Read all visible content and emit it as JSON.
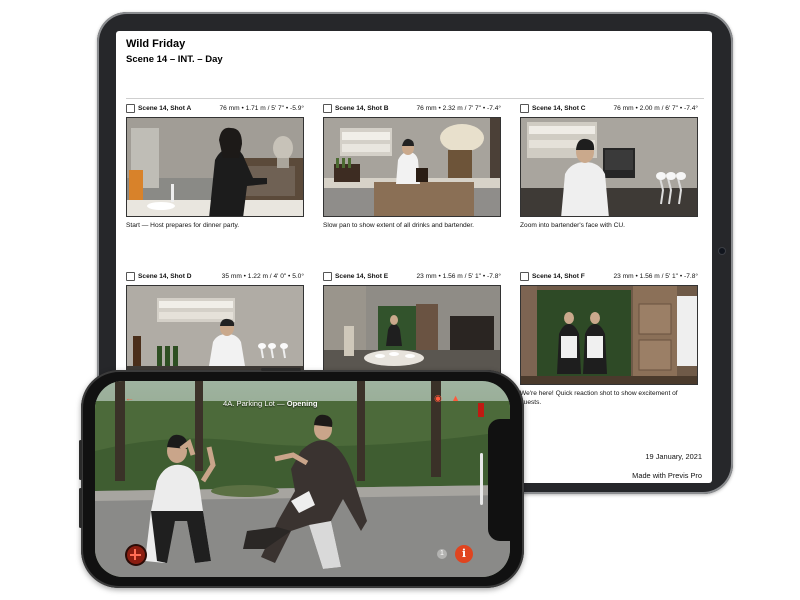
{
  "document": {
    "title": "Wild Friday",
    "scene": "Scene 14 – INT. – Day",
    "date": "19 January, 2021",
    "footer": "Made with Previs Pro"
  },
  "shots": [
    {
      "name": "Scene 14, Shot A",
      "lens": "76 mm • 1.71 m / 5' 7\" • -5.9°",
      "caption": "Start — Host prepares for dinner party."
    },
    {
      "name": "Scene 14, Shot B",
      "lens": "76 mm • 2.32 m / 7' 7\" • -7.4°",
      "caption": "Slow pan to show extent of all drinks and bartender."
    },
    {
      "name": "Scene 14, Shot C",
      "lens": "76 mm • 2.00 m / 6' 7\" • -7.4°",
      "caption": "Zoom into bartender's face with CU."
    },
    {
      "name": "Scene 14, Shot D",
      "lens": "35 mm • 1.22 m / 4' 0\" • 5.0°",
      "caption": ""
    },
    {
      "name": "Scene 14, Shot E",
      "lens": "23 mm • 1.56 m / 5' 1\" • -7.8°",
      "caption": ""
    },
    {
      "name": "Scene 14, Shot F",
      "lens": "23 mm • 1.56 m / 5' 1\" • -7.8°",
      "caption": "We're here! Quick reaction shot to show excitement of guests."
    }
  ],
  "phone": {
    "scene_prefix": "4A. Parking Lot — ",
    "scene_name": "Opening",
    "dim_badge": "1",
    "info_badge": "i"
  },
  "icons": {
    "record": "record-add-icon",
    "info": "info-icon",
    "eye": "eye-icon"
  },
  "colors": {
    "accent": "#e0441f",
    "device": "#26272a"
  }
}
